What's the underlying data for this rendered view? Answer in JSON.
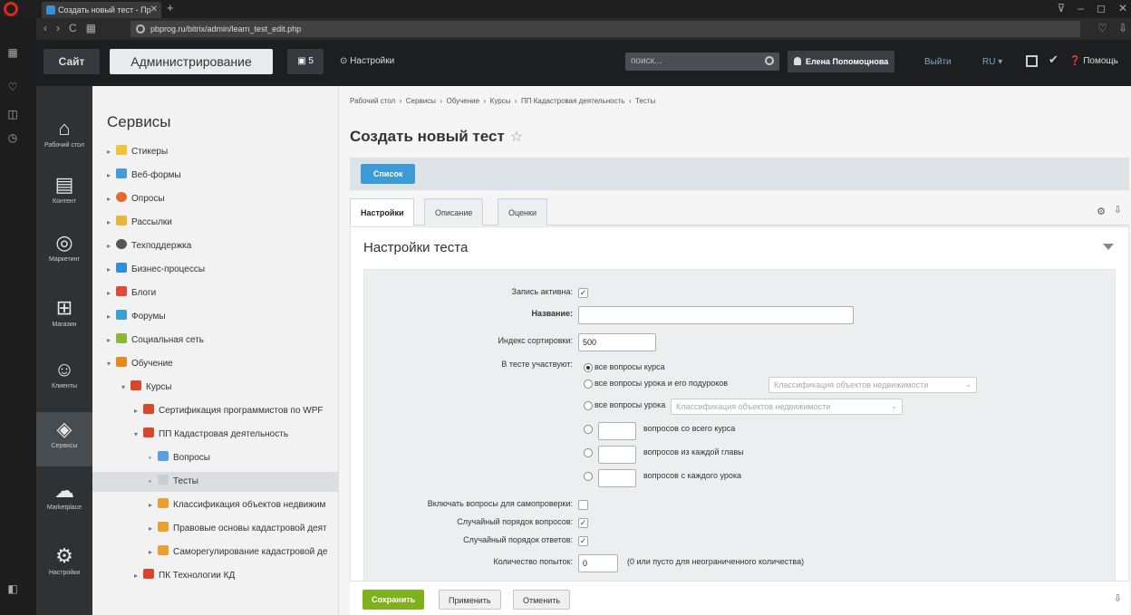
{
  "browser": {
    "tab_title": "Создать новый тест - Пр",
    "new_tab": "+",
    "url": "pbprog.ru/bitrix/admin/learn_test_edit.php"
  },
  "panel": {
    "site_label": "Сайт",
    "admin_label": "Администрирование",
    "notify_count": "5",
    "settings_label": "Настройки",
    "search_placeholder": "поиск...",
    "user_name": "Елена Попомоцнова",
    "logout_label": "Выйти",
    "lang_label": "RU",
    "help_label": "Помощь"
  },
  "menu": {
    "items": [
      {
        "label": "Рабочий стол",
        "icon": "home-icon"
      },
      {
        "label": "Контент",
        "icon": "document-icon"
      },
      {
        "label": "Маркетинг",
        "icon": "target-icon"
      },
      {
        "label": "Магазин",
        "icon": "cart-icon"
      },
      {
        "label": "Клиенты",
        "icon": "clients-icon"
      },
      {
        "label": "Сервисы",
        "icon": "layers-icon"
      },
      {
        "label": "Marketplace",
        "icon": "cloud-icon"
      },
      {
        "label": "Настройки",
        "icon": "gear-icon"
      }
    ]
  },
  "tree": {
    "title": "Сервисы",
    "items": [
      {
        "label": "Стикеры"
      },
      {
        "label": "Веб-формы"
      },
      {
        "label": "Опросы"
      },
      {
        "label": "Рассылки"
      },
      {
        "label": "Техподдержка"
      },
      {
        "label": "Бизнес-процессы"
      },
      {
        "label": "Блоги"
      },
      {
        "label": "Форумы"
      },
      {
        "label": "Социальная сеть"
      },
      {
        "label": "Обучение"
      },
      {
        "label": "Курсы"
      },
      {
        "label": "Сертификация программистов по WPF"
      },
      {
        "label": "ПП Кадастровая деятельность"
      },
      {
        "label": "Вопросы"
      },
      {
        "label": "Тесты"
      },
      {
        "label": "Классификация объектов недвижим"
      },
      {
        "label": "Правовые основы кадастровой деят"
      },
      {
        "label": "Саморегулирование кадастровой де"
      },
      {
        "label": "ПК Технологии КД"
      }
    ]
  },
  "breadcrumb": [
    "Рабочий стол",
    "Сервисы",
    "Обучение",
    "Курсы",
    "ПП Кадастровая деятельность",
    "Тесты"
  ],
  "page_title": "Создать новый тест",
  "list_button": "Список",
  "tabs": [
    "Настройки",
    "Описание",
    "Оценки"
  ],
  "section_title": "Настройки теста",
  "form": {
    "active_label": "Запись активна:",
    "name_label": "Название:",
    "name_value": "",
    "sort_label": "Индекс сортировки:",
    "sort_value": "500",
    "participants_label": "В тесте участвуют:",
    "opt_all_course": "все вопросы курса",
    "opt_lesson_sub": "все вопросы урока и его подуроков",
    "opt_lesson_sub_select": "Классификация объектов недвижимости",
    "opt_lesson": "все вопросы урока",
    "opt_lesson_select": "Классификация объектов недвижимости",
    "opt_from_course": "вопросов со всего курса",
    "opt_from_chapter": "вопросов из каждой главы",
    "opt_from_lesson": "вопросов с каждого урока",
    "self_check_label": "Включать вопросы для самопроверки:",
    "random_questions_label": "Случайный порядок вопросов:",
    "random_answers_label": "Случайный порядок ответов:",
    "attempts_label": "Количество попыток:",
    "attempts_value": "0",
    "attempts_hint": "(0 или пусто для неограниченного количества)"
  },
  "footer": {
    "save": "Сохранить",
    "apply": "Применить",
    "cancel": "Отменить"
  }
}
